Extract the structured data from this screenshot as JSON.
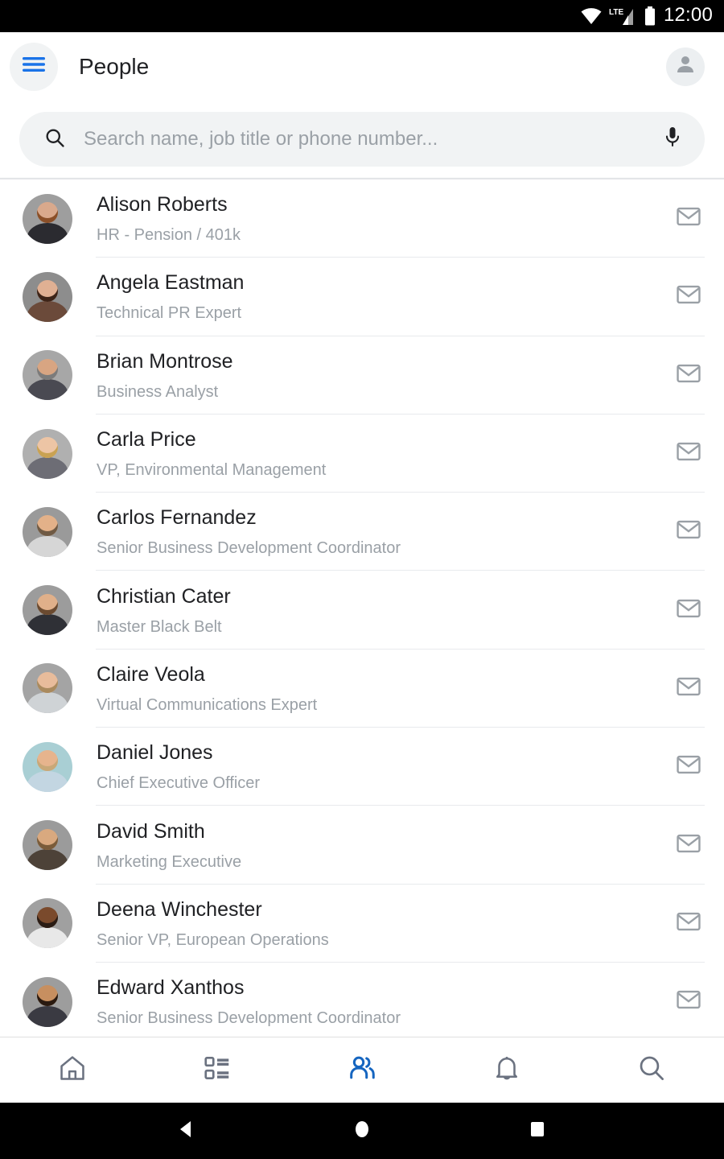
{
  "statusbar": {
    "time": "12:00",
    "network": "LTE",
    "icons": [
      "wifi-icon",
      "lte-signal-icon",
      "battery-icon"
    ]
  },
  "appbar": {
    "title": "People",
    "menu_icon": "hamburger-menu-icon",
    "profile_icon": "account-avatar-icon",
    "menu_color": "#1a73e8"
  },
  "search": {
    "placeholder": "Search name, job title or phone number...",
    "search_icon": "search-icon",
    "mic_icon": "microphone-icon"
  },
  "people": [
    {
      "name": "Alison Roberts",
      "job": "HR - Pension / 401k",
      "skin": "#d9a98c",
      "hair": "#8a4f28",
      "cloth": "#2b2b30",
      "bg": "#9e9e9e"
    },
    {
      "name": "Angela Eastman",
      "job": "Technical PR Expert",
      "skin": "#e0b093",
      "hair": "#3d2418",
      "cloth": "#6b4a3a",
      "bg": "#8d8d8d"
    },
    {
      "name": "Brian Montrose",
      "job": "Business Analyst",
      "skin": "#d8a582",
      "hair": "#7b7b7b",
      "cloth": "#4a4a52",
      "bg": "#a7a7a7"
    },
    {
      "name": "Carla Price",
      "job": "VP, Environmental Management",
      "skin": "#edc5a5",
      "hair": "#c9a253",
      "cloth": "#6d6d75",
      "bg": "#b0b0b0"
    },
    {
      "name": "Carlos Fernandez",
      "job": "Senior Business Development Coordinator",
      "skin": "#e3b189",
      "hair": "#6f5a44",
      "cloth": "#d6d6d6",
      "bg": "#9a9a9a"
    },
    {
      "name": "Christian Cater",
      "job": "Master Black Belt",
      "skin": "#e0b08a",
      "hair": "#6a4a30",
      "cloth": "#2f3036",
      "bg": "#9c9c9c"
    },
    {
      "name": "Claire Veola",
      "job": "Virtual Communications Expert",
      "skin": "#e8bc9b",
      "hair": "#a98a5e",
      "cloth": "#cfd3d6",
      "bg": "#a4a4a4"
    },
    {
      "name": "Daniel Jones",
      "job": "Chief Executive Officer",
      "skin": "#e6b48d",
      "hair": "#c8a878",
      "cloth": "#c3d6e2",
      "bg": "#a9cfd4"
    },
    {
      "name": "David Smith",
      "job": "Marketing Executive",
      "skin": "#d9a97f",
      "hair": "#7a5c3a",
      "cloth": "#4d4238",
      "bg": "#9b9b9b"
    },
    {
      "name": "Deena Winchester",
      "job": "Senior VP, European Operations",
      "skin": "#7a4a2c",
      "hair": "#2a1c14",
      "cloth": "#e8e8e8",
      "bg": "#a0a0a0"
    },
    {
      "name": "Edward Xanthos",
      "job": "Senior Business Development Coordinator",
      "skin": "#c78f60",
      "hair": "#2a1a10",
      "cloth": "#3a3a42",
      "bg": "#9d9d9d"
    }
  ],
  "row_action_icon": "mail-envelope-icon",
  "bottomnav": {
    "active_color": "#1565c0",
    "inactive_color": "#6b7280",
    "items": [
      {
        "icon": "home-icon",
        "name": "home",
        "active": false
      },
      {
        "icon": "list-icon",
        "name": "list",
        "active": false
      },
      {
        "icon": "people-icon",
        "name": "people",
        "active": true
      },
      {
        "icon": "bell-icon",
        "name": "notifications",
        "active": false
      },
      {
        "icon": "search-icon",
        "name": "search",
        "active": false
      }
    ]
  },
  "sysnav": {
    "back_icon": "triangle-back-icon",
    "home_icon": "circle-home-icon",
    "recents_icon": "square-recents-icon"
  }
}
